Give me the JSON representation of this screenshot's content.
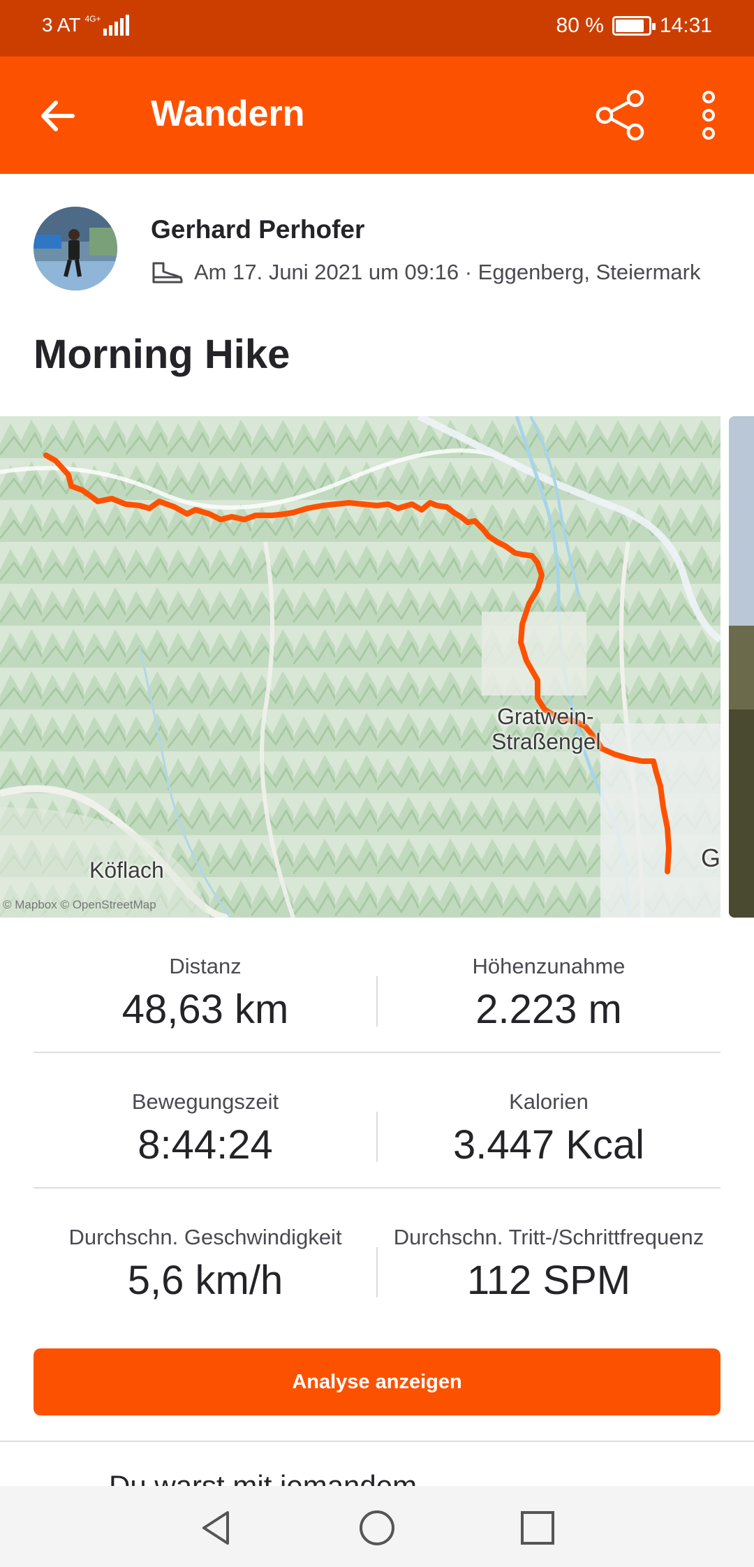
{
  "status_bar": {
    "carrier": "3 AT",
    "network": "4G+",
    "battery_percent": "80 %",
    "battery_level": 0.8,
    "time": "14:31"
  },
  "app_bar": {
    "title": "Wandern",
    "back_icon": "arrow-left-icon",
    "share_icon": "share-icon",
    "more_icon": "more-vertical-icon"
  },
  "athlete": {
    "name": "Gerhard Perhofer",
    "meta": "Am 17. Juni 2021 um 09:16 · Eggenberg, Steiermark",
    "sport_icon": "hiking-shoe-icon"
  },
  "activity": {
    "title": "Morning Hike"
  },
  "map": {
    "labels": {
      "town1_line1": "Gratwein-",
      "town1_line2": "Straßengel",
      "town2": "Köflach",
      "edge": "G"
    },
    "attribution": "© Mapbox © OpenStreetMap",
    "route_color": "#fc5200"
  },
  "stats": [
    {
      "left": {
        "label": "Distanz",
        "value": "48,63 km"
      },
      "right": {
        "label": "Höhenzunahme",
        "value": "2.223 m"
      }
    },
    {
      "left": {
        "label": "Bewegungszeit",
        "value": "8:44:24"
      },
      "right": {
        "label": "Kalorien",
        "value": "3.447 Kcal"
      }
    },
    {
      "left": {
        "label": "Durchschn. Geschwindigkeit",
        "value": "5,6 km/h"
      },
      "right": {
        "label": "Durchschn. Tritt-/Schrittfrequenz",
        "value": "112 SPM"
      }
    }
  ],
  "actions": {
    "analyse_label": "Analyse anzeigen"
  },
  "partial_section": {
    "text": "Du warst mit jemandem"
  },
  "colors": {
    "brand": "#fc5200",
    "status_bar": "#cc3e00"
  }
}
